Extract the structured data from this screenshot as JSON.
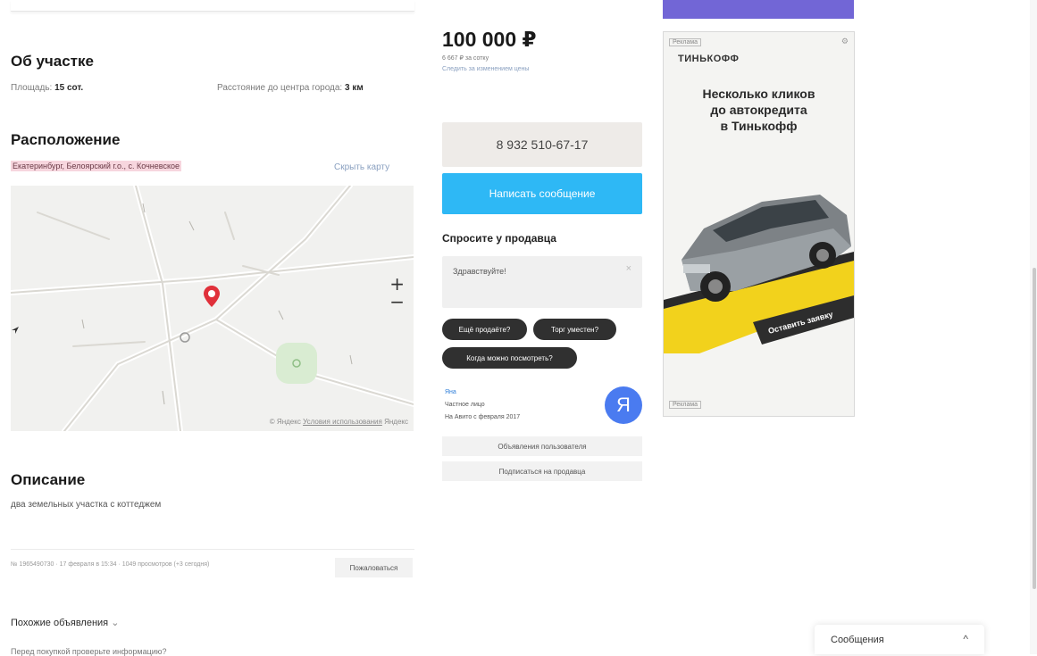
{
  "plot": {
    "title": "Об участке",
    "area_label": "Площадь:",
    "area_value": "15 сот.",
    "distance_label": "Расстояние до центра города:",
    "distance_value": "3 км"
  },
  "location": {
    "title": "Расположение",
    "address": "Екатеринбург, Белоярский г.о., с. Кочневское",
    "hide_map": "Скрыть карту"
  },
  "map": {
    "zoom_in": "+",
    "zoom_out": "−",
    "footer_brand": "© Яндекс",
    "footer_terms": "Условия использования",
    "footer_yandex": "Яндекс",
    "pin_color": "#e0303a"
  },
  "description": {
    "title": "Описание",
    "text": "два земельных участка с коттеджем",
    "meta": "№ 1965490730 · 17 февраля в 15:34 · 1049 просмотров (+3 сегодня)",
    "report_button": "Пожаловаться"
  },
  "similar": {
    "title": "Похожие объявления",
    "question": "Перед покупкой проверьте информацию?"
  },
  "price": {
    "value": "100 000 ₽",
    "per_unit": "6 667 ₽ за сотку",
    "history_link": "Следить за изменением цены"
  },
  "contact": {
    "phone": "8 932 510-67-17",
    "message_button": "Написать сообщение",
    "brand_color": "#2eb8f5"
  },
  "ask": {
    "title": "Спросите у продавца",
    "placeholder": "Здравствуйте!",
    "chips": [
      "Ещё продаёте?",
      "Торг уместен?",
      "Когда можно посмотреть?"
    ]
  },
  "seller": {
    "name": "Яна",
    "type": "Частное лицо",
    "since": "На Авито с февраля 2017",
    "avatar_letter": "Я",
    "other_ads_button": "Объявления пользователя",
    "subscribe_button": "Подписаться на продавца"
  },
  "ad": {
    "label": "Реклама",
    "brand": "ТИНЬКОФФ",
    "headline": "Несколько кликов\nдо автокредита\nв Тинькофф",
    "cta": "Оставить заявку",
    "bottom_label": "Реклама"
  },
  "messenger": {
    "label": "Сообщения",
    "toggle": "^"
  }
}
